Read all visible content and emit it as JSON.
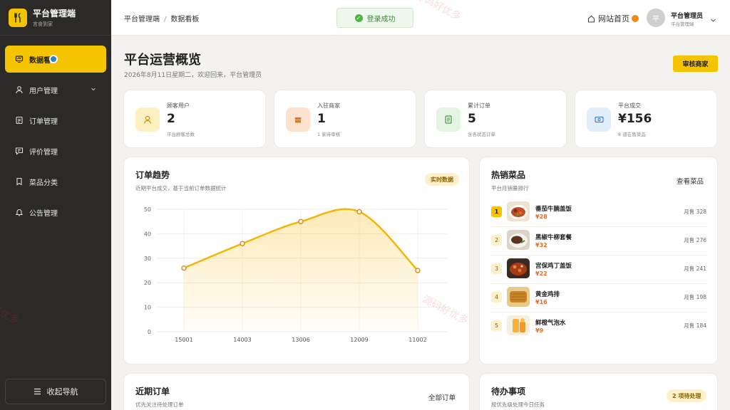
{
  "brand": {
    "title": "平台管理端",
    "subtitle": "言食到家"
  },
  "sidebar": {
    "items": [
      {
        "label": "数据看",
        "icon": "dashboard-icon"
      },
      {
        "label": "用户管理",
        "icon": "user-icon"
      },
      {
        "label": "订单管理",
        "icon": "order-icon"
      },
      {
        "label": "评价管理",
        "icon": "comment-icon"
      },
      {
        "label": "菜品分类",
        "icon": "bookmark-icon"
      },
      {
        "label": "公告管理",
        "icon": "bell-icon"
      }
    ],
    "collapse_label": "收起导航"
  },
  "header": {
    "breadcrumb": [
      "平台管理端",
      "数据看板"
    ],
    "toast": "登录成功",
    "home_link": "网站首页",
    "avatar_char": "平",
    "user_name": "平台管理员",
    "user_role": "平台管理端"
  },
  "page": {
    "title": "平台运营概览",
    "date": "2026年8月11日星期二，欢迎回来，平台管理员",
    "audit_button": "审核商家"
  },
  "stats": [
    {
      "label": "顾客用户",
      "value": "2",
      "sub": "平台顾客总数",
      "icon": "user-icon",
      "color": "#fdf0c2",
      "icon_color": "#c99400"
    },
    {
      "label": "入驻商家",
      "value": "1",
      "sub": "1 家待审核",
      "icon": "store-icon",
      "color": "#fde3cf",
      "icon_color": "#e07a20"
    },
    {
      "label": "累计订单",
      "value": "5",
      "sub": "含各状态订单",
      "icon": "document-icon",
      "color": "#e4f3e2",
      "icon_color": "#4c9a43"
    },
    {
      "label": "平台成交",
      "value": "¥156",
      "sub": "8 道在售菜品",
      "icon": "money-icon",
      "color": "#e3eefa",
      "icon_color": "#3f7fc4"
    }
  ],
  "trend": {
    "title": "订单趋势",
    "subtitle": "近期平台成交，基于当前订单数据统计",
    "badge": "实时数据"
  },
  "chart_data": {
    "type": "area",
    "categories": [
      "15001",
      "14003",
      "13006",
      "12009",
      "11002"
    ],
    "values": [
      26,
      36,
      45,
      49,
      25
    ],
    "ylim": [
      0,
      50
    ],
    "yticks": [
      0,
      10,
      20,
      30,
      40,
      50
    ],
    "grid": true,
    "color": "#f5b400"
  },
  "hot": {
    "title": "热销菜品",
    "subtitle": "平台月销量排行",
    "link": "查看菜品",
    "items": [
      {
        "rank": "1",
        "name": "番茄牛腩盖饭",
        "price": "¥28",
        "sales": "月售 328"
      },
      {
        "rank": "2",
        "name": "黑椒牛柳套餐",
        "price": "¥32",
        "sales": "月售 276"
      },
      {
        "rank": "3",
        "name": "宫保鸡丁盖饭",
        "price": "¥22",
        "sales": "月售 241"
      },
      {
        "rank": "4",
        "name": "黄金鸡排",
        "price": "¥16",
        "sales": "月售 198"
      },
      {
        "rank": "5",
        "name": "鲜橙气泡水",
        "price": "¥9",
        "sales": "月售 184"
      }
    ]
  },
  "recent": {
    "title": "近期订单",
    "subtitle": "优先关注待处理订单",
    "link": "全部订单"
  },
  "todo": {
    "title": "待办事项",
    "subtitle": "按优先级处理今日任务",
    "badge": "2 项待处理"
  },
  "watermark": "源码好优多"
}
